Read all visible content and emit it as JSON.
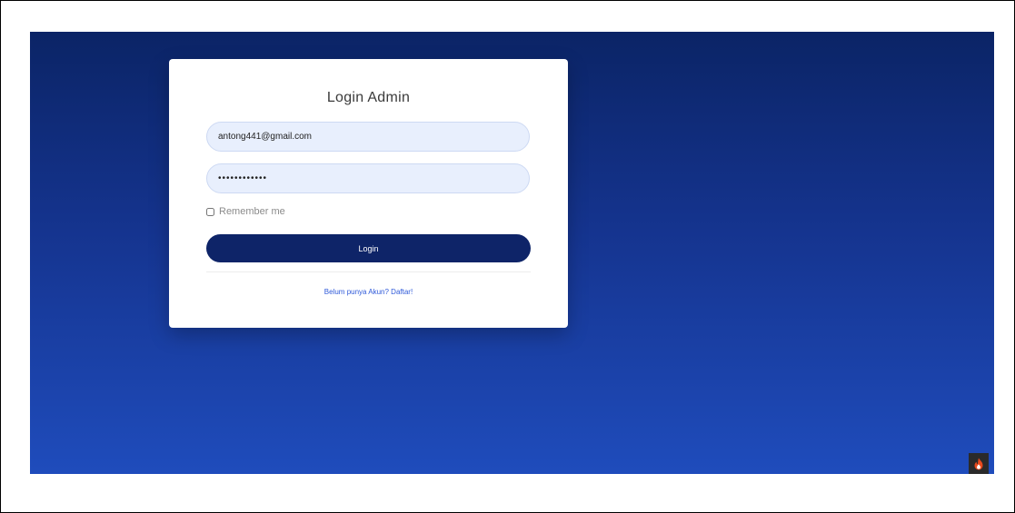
{
  "login": {
    "title": "Login Admin",
    "email_value": "antong441@gmail.com",
    "password_value": "••••••••••••",
    "remember_label": "Remember me",
    "login_button": "Login",
    "register_link": "Belum punya Akun? Daftar!"
  },
  "colors": {
    "background_top": "#0b2466",
    "background_bottom": "#1f4cbc",
    "button": "#0e2468",
    "input_fill": "#e8effd",
    "link": "#2e59d9"
  },
  "icons": {
    "debug_toolbar": "codeigniter-flame-icon"
  }
}
